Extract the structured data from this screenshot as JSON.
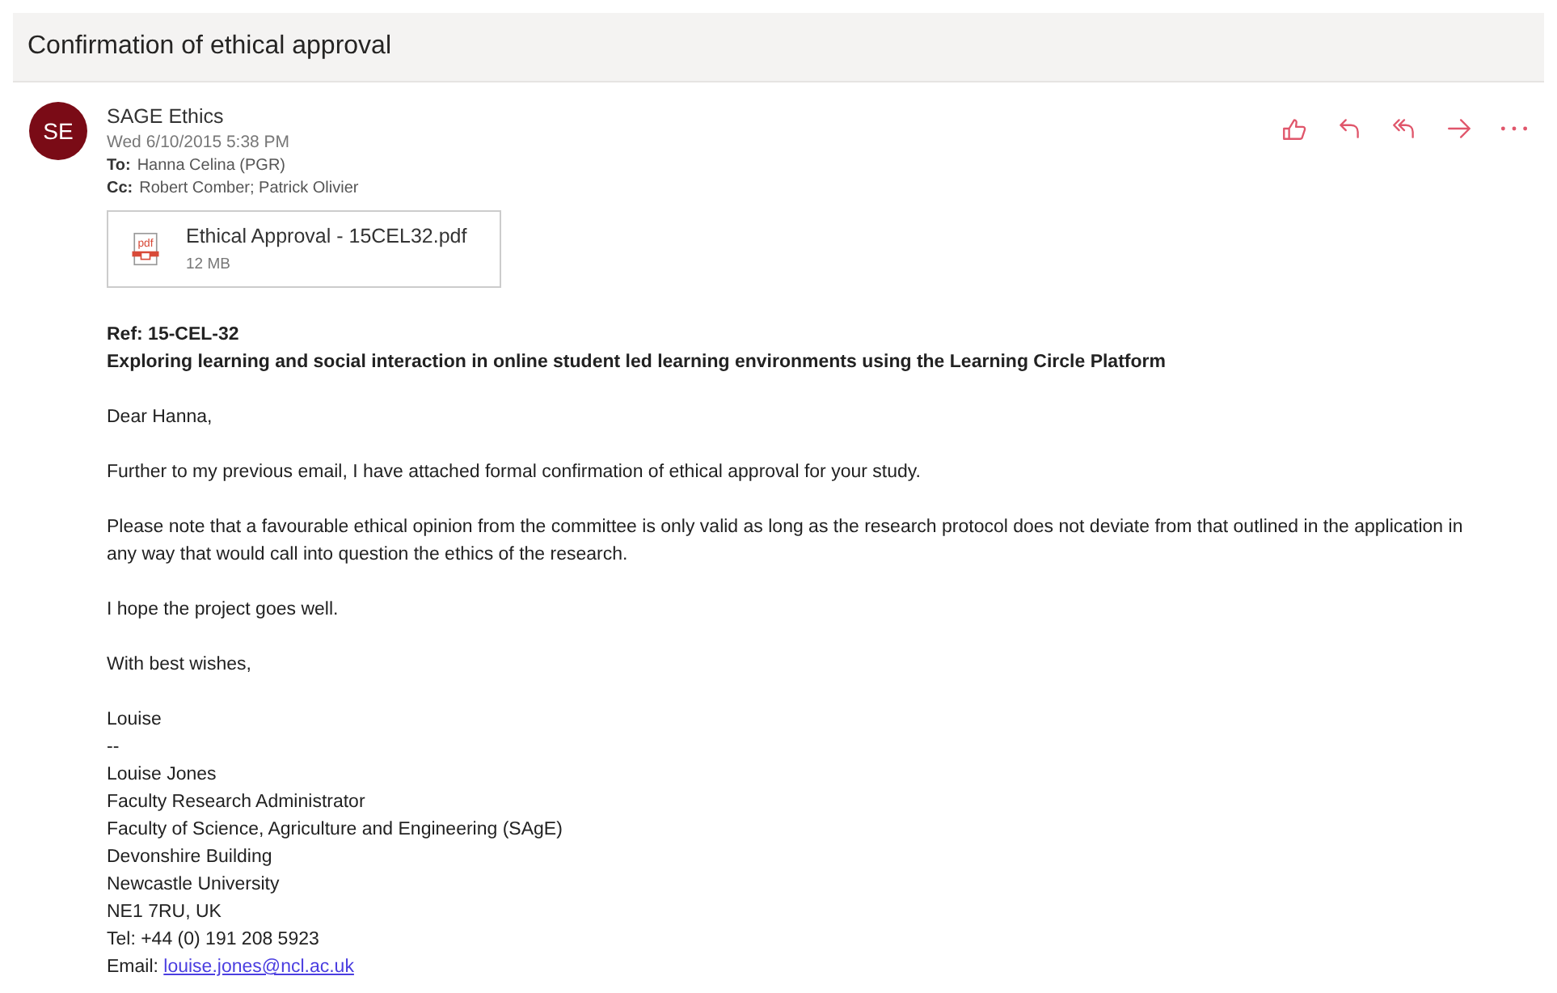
{
  "subject": "Confirmation of ethical approval",
  "sender": {
    "initials": "SE",
    "name": "SAGE Ethics",
    "date": "Wed 6/10/2015 5:38 PM",
    "to_label": "To:",
    "to": "Hanna Celina (PGR)",
    "cc_label": "Cc:",
    "cc": "Robert Comber; Patrick Olivier"
  },
  "actions": [
    {
      "kind": "like"
    },
    {
      "kind": "reply"
    },
    {
      "kind": "reply-all"
    },
    {
      "kind": "forward"
    },
    {
      "kind": "more"
    }
  ],
  "attachment": {
    "icon_label": "pdf",
    "name": "Ethical Approval - 15CEL32.pdf",
    "size": "12 MB"
  },
  "body": [
    {
      "lines": [
        {
          "text": "Ref: 15-CEL-32",
          "bold": true
        },
        {
          "text": "Exploring learning and social interaction in online student led learning environments using the Learning Circle Platform",
          "bold": true
        }
      ]
    },
    {
      "lines": [
        {
          "text": "Dear Hanna,"
        }
      ]
    },
    {
      "lines": [
        {
          "text": "Further to my previous email, I have attached formal confirmation of ethical approval for your study."
        }
      ]
    },
    {
      "lines": [
        {
          "text": "Please note that a favourable ethical opinion from the committee is only valid as long as the research protocol does not deviate from that outlined in the application in any way that would call into question the ethics of the research."
        }
      ]
    },
    {
      "lines": [
        {
          "text": "I hope the project goes well."
        }
      ]
    },
    {
      "lines": [
        {
          "text": "With best wishes,"
        }
      ]
    },
    {
      "lines": [
        {
          "text": "Louise"
        },
        {
          "text": "--"
        },
        {
          "text": "Louise Jones"
        },
        {
          "text": "Faculty Research Administrator"
        },
        {
          "text": "Faculty of Science, Agriculture and Engineering (SAgE)"
        },
        {
          "text": "Devonshire Building"
        },
        {
          "text": "Newcastle University"
        },
        {
          "text": "NE1 7RU, UK"
        },
        {
          "text": "Tel: +44 (0) 191 208 5923"
        },
        {
          "text": "Email:",
          "link": "louise.jones@ncl.ac.uk"
        }
      ]
    }
  ]
}
